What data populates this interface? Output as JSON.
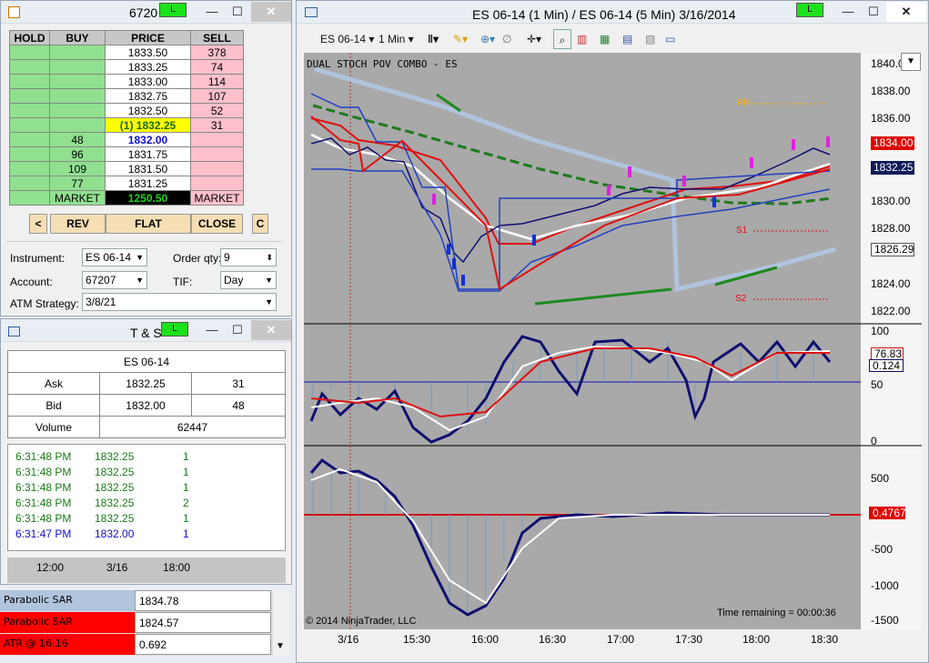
{
  "dom_window": {
    "title": "6720",
    "l_badge": "L",
    "minimize": "—",
    "maximize": "☐",
    "close": "✕",
    "headers": {
      "hold": "HOLD",
      "buy": "BUY",
      "price": "PRICE",
      "sell": "SELL"
    },
    "rows": [
      {
        "buy": "",
        "price": "1833.50",
        "sell": "378"
      },
      {
        "buy": "",
        "price": "1833.25",
        "sell": "74"
      },
      {
        "buy": "",
        "price": "1833.00",
        "sell": "114"
      },
      {
        "buy": "",
        "price": "1832.75",
        "sell": "107"
      },
      {
        "buy": "",
        "price": "1832.50",
        "sell": "52"
      },
      {
        "buy": "",
        "price": "(1) 1832.25",
        "sell": "31"
      },
      {
        "buy": "48",
        "price": "1832.00",
        "sell": ""
      },
      {
        "buy": "96",
        "price": "1831.75",
        "sell": ""
      },
      {
        "buy": "109",
        "price": "1831.50",
        "sell": ""
      },
      {
        "buy": "77",
        "price": "1831.25",
        "sell": ""
      }
    ],
    "market_buy": "MARKET",
    "market_price": "1250.50",
    "market_sell": "MARKET",
    "buttons": {
      "left": "<",
      "rev": "REV",
      "flat": "FLAT",
      "close": "CLOSE",
      "c": "C"
    },
    "form": {
      "instrument_label": "Instrument:",
      "instrument": "ES 06-14",
      "order_qty_label": "Order qty:",
      "order_qty": "9",
      "account_label": "Account:",
      "account": "67207",
      "tif_label": "TIF:",
      "tif": "Day",
      "atm_label": "ATM Strategy:",
      "atm": "3/8/21"
    }
  },
  "ts_window": {
    "title": "T & S",
    "l_badge": "L",
    "minimize": "—",
    "maximize": "☐",
    "close": "✕",
    "instrument": "ES 06-14",
    "ask_label": "Ask",
    "ask_price": "1832.25",
    "ask_size": "31",
    "bid_label": "Bid",
    "bid_price": "1832.00",
    "bid_size": "48",
    "volume_label": "Volume",
    "volume": "62447",
    "trades": [
      {
        "time": "6:31:48 PM",
        "price": "1832.25",
        "size": "1",
        "color": "#1a7a1a"
      },
      {
        "time": "6:31:48 PM",
        "price": "1832.25",
        "size": "1",
        "color": "#1a7a1a"
      },
      {
        "time": "6:31:48 PM",
        "price": "1832.25",
        "size": "1",
        "color": "#1a7a1a"
      },
      {
        "time": "6:31:48 PM",
        "price": "1832.25",
        "size": "2",
        "color": "#1a7a1a"
      },
      {
        "time": "6:31:48 PM",
        "price": "1832.25",
        "size": "1",
        "color": "#1a7a1a"
      },
      {
        "time": "6:31:47 PM",
        "price": "1832.00",
        "size": "1",
        "color": "#1010c0"
      }
    ],
    "mini_axis": [
      "12:00",
      "3/16",
      "18:00"
    ]
  },
  "data_grid": [
    {
      "name": "Parabolic SAR",
      "value": "1834.78",
      "color": "#b0c4de"
    },
    {
      "name": "Parabolic SAR",
      "value": "1824.57",
      "color": "#ff0000"
    },
    {
      "name": "ATR @ 16:16",
      "value": "0.692",
      "color": "#ff0000"
    }
  ],
  "chart_window": {
    "title": "ES 06-14 (1 Min) / ES 06-14 (5 Min)  3/16/2014",
    "l_badge": "L",
    "minimize": "—",
    "maximize": "☐",
    "close": "✕",
    "toolbar": {
      "instrument": "ES 06-14",
      "interval": "1 Min"
    },
    "indicator_label": "DUAL STOCH POV COMBO - ES",
    "copyright": "© 2014 NinjaTrader, LLC",
    "time_remaining": "Time remaining = 00:00:36",
    "pivots": {
      "pp": "PP",
      "s1": "S1",
      "s2": "S2"
    },
    "price_axis": [
      "1840.0",
      "1838.00",
      "1836.00",
      "1834.00",
      "1832.25",
      "1830.00",
      "1828.00",
      "1826.29",
      "1824.00",
      "1822.00"
    ],
    "price_badges": {
      "red": "1834.00",
      "navy": "1832.25",
      "white": "1826.29"
    },
    "stoch_axis": [
      "100",
      "50",
      "0"
    ],
    "stoch_badges": {
      "a": "76.83",
      "b": "0.124"
    },
    "osc_axis": [
      "500",
      "0",
      "-500",
      "-1000",
      "-1500"
    ],
    "osc_badge": "0.4767",
    "x_axis": [
      "3/16",
      "15:30",
      "16:00",
      "16:30",
      "17:00",
      "17:30",
      "18:00",
      "18:30"
    ]
  }
}
